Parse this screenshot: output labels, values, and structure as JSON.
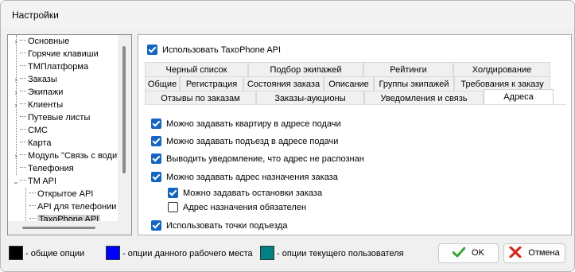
{
  "window": {
    "title": "Настройки"
  },
  "tree": {
    "items": [
      {
        "label": "Основные",
        "expandable": true
      },
      {
        "label": "Горячие клавиши",
        "expandable": false
      },
      {
        "label": "ТМПлатформа",
        "expandable": false
      },
      {
        "label": "Заказы",
        "expandable": true
      },
      {
        "label": "Экипажи",
        "expandable": true
      },
      {
        "label": "Клиенты",
        "expandable": true
      },
      {
        "label": "Путевые листы",
        "expandable": false
      },
      {
        "label": "СМС",
        "expandable": false
      },
      {
        "label": "Карта",
        "expandable": false
      },
      {
        "label": "Модуль \"Связь с водит",
        "expandable": true
      },
      {
        "label": "Телефония",
        "expandable": false
      },
      {
        "label": "TM API",
        "expandable": true,
        "expanded": true
      },
      {
        "label": "Открытое API",
        "expandable": false,
        "child": true
      },
      {
        "label": "API для телефонии",
        "expandable": false,
        "child": true
      },
      {
        "label": "TaxoPhone API",
        "expandable": false,
        "child": true,
        "selected": true
      }
    ]
  },
  "main": {
    "use_api_label": "Использовать TaxoPhone API",
    "use_api_checked": true,
    "tabs_row1": [
      "Черный список",
      "Подбор экипажей",
      "Рейтинги",
      "Холдирование"
    ],
    "tabs_row2": [
      "Общие",
      "Регистрация",
      "Состояния заказа",
      "Описание",
      "Группы экипажей",
      "Требования к заказу"
    ],
    "tabs_row3": [
      "Отзывы по заказам",
      "Заказы-аукционы",
      "Уведомления и связь",
      "Адреса"
    ],
    "active_tab": "Адреса",
    "options": [
      {
        "label": "Можно задавать квартиру в адресе подачи",
        "checked": true
      },
      {
        "label": "Можно задавать подъезд в адресе подачи",
        "checked": true
      },
      {
        "label": "Выводить уведомление, что адрес не распознан",
        "checked": true
      },
      {
        "label": "Можно задавать адрес назначения заказа",
        "checked": true
      },
      {
        "label": "Можно задавать остановки заказа",
        "checked": true
      },
      {
        "label": "Адрес назначения обязателен",
        "checked": false
      },
      {
        "label": "Использовать точки подъезда",
        "checked": true
      }
    ]
  },
  "legend": [
    {
      "color": "#000000",
      "text": "- общие опции"
    },
    {
      "color": "#0000ff",
      "text": "- опции данного рабочего места"
    },
    {
      "color": "#008080",
      "text": "- опции текущего пользователя"
    }
  ],
  "buttons": {
    "ok": "OK",
    "cancel": "Отмена"
  },
  "icons": {
    "ok": "check-icon",
    "cancel": "cross-icon"
  }
}
